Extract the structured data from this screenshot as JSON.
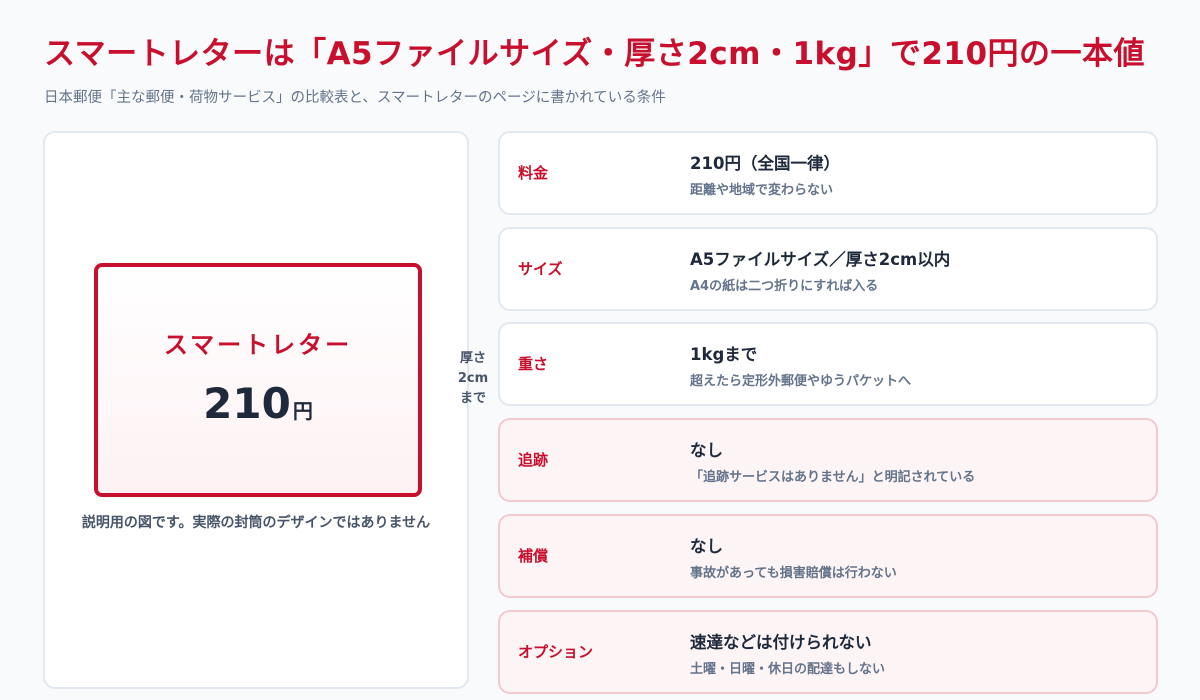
{
  "header": {
    "title": "スマートレターは「A5ファイルサイズ・厚さ2cm・1kg」で210円の一本値",
    "subtitle": "日本郵便「主な郵便・荷物サービス」の比較表と、スマートレターのページに書かれている条件"
  },
  "illustration": {
    "name": "スマートレター",
    "price": "210",
    "price_unit": "円",
    "thickness_label": "厚さ\n2cm\nまで",
    "caption": "説明用の図です。実際の封筒のデザインではありません"
  },
  "rows": [
    {
      "label": "料金",
      "main": "210円（全国一律）",
      "note": "距離や地域で変わらない",
      "warn": false
    },
    {
      "label": "サイズ",
      "main": "A5ファイルサイズ／厚さ2cm以内",
      "note": "A4の紙は二つ折りにすれば入る",
      "warn": false
    },
    {
      "label": "重さ",
      "main": "1kgまで",
      "note": "超えたら定形外郵便やゆうパケットへ",
      "warn": false
    },
    {
      "label": "追跡",
      "main": "なし",
      "note": "「追跡サービスはありません」と明記されている",
      "warn": true
    },
    {
      "label": "補償",
      "main": "なし",
      "note": "事故があっても損害賠償は行わない",
      "warn": true
    },
    {
      "label": "オプション",
      "main": "速達などは付けられない",
      "note": "土曜・日曜・休日の配達もしない",
      "warn": true
    }
  ],
  "colors": {
    "accent": "#c8102e",
    "warn_background": "#fdf4f5",
    "warn_border": "#f1c9cf"
  }
}
